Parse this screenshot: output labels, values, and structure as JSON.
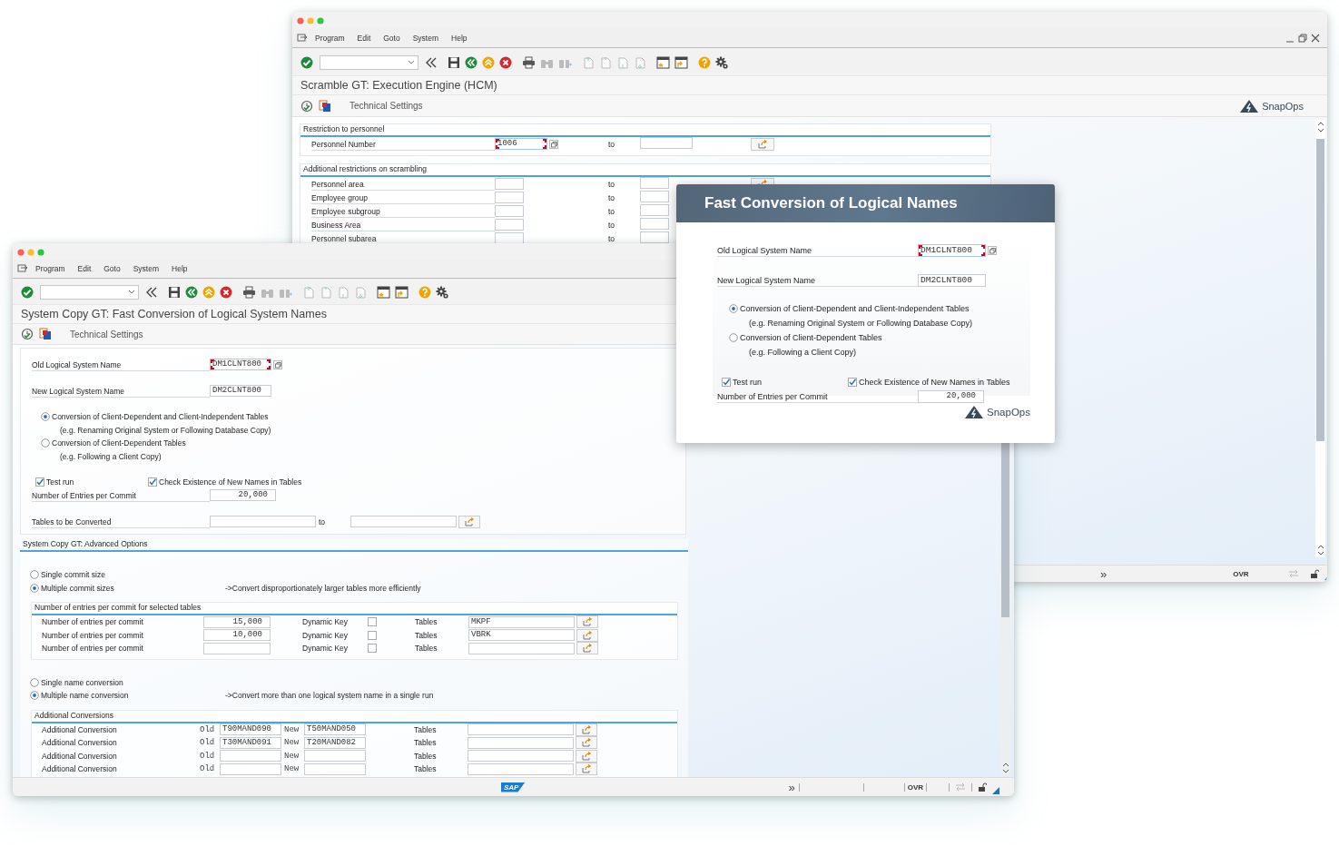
{
  "back_window": {
    "menu": [
      "Program",
      "Edit",
      "Goto",
      "System",
      "Help"
    ],
    "title": "Scramble GT: Execution Engine (HCM)",
    "app_toolbar": [
      "Technical Settings"
    ],
    "brand": "SnapOps",
    "groups": [
      {
        "title": "Restriction to personnel",
        "rows": [
          {
            "label": "Personnel Number",
            "low": "1006",
            "focused": true,
            "to": "to"
          }
        ]
      },
      {
        "title": "Additional restrictions on scrambling",
        "rows": [
          {
            "label": "Personnel area",
            "focused": false,
            "to": "to"
          },
          {
            "label": "Employee group",
            "focused": false,
            "to": "to"
          },
          {
            "label": "Employee subgroup",
            "focused": false,
            "to": "to"
          },
          {
            "label": "Business Area",
            "focused": false,
            "to": "to"
          },
          {
            "label": "Personnel subarea",
            "focused": false,
            "to": "to"
          }
        ]
      }
    ],
    "status": {
      "expand": "»",
      "mode": "OVR"
    }
  },
  "front_window": {
    "menu": [
      "Program",
      "Edit",
      "Goto",
      "System",
      "Help"
    ],
    "title": "System Copy GT: Fast Conversion of Logical System Names",
    "app_toolbar": [
      "Technical Settings"
    ],
    "old_name": {
      "label": "Old Logical System Name",
      "value": "DM1CLNT800",
      "focused": true
    },
    "new_name": {
      "label": "New Logical System Name",
      "value": "DM2CLNT800",
      "focused": false
    },
    "scope_options": [
      {
        "label": "Conversion of Client-Dependent and Client-Independent Tables",
        "hint": "(e.g. Renaming Original System or Following Database Copy)",
        "selected": true
      },
      {
        "label": "Conversion of Client-Dependent Tables",
        "hint": "(e.g. Following a Client Copy)",
        "selected": false
      }
    ],
    "checks": [
      {
        "label": "Test run",
        "checked": true
      },
      {
        "label": "Check Existence of New Names in Tables",
        "checked": true
      }
    ],
    "entries_per_commit": {
      "label": "Number of Entries per Commit",
      "value": "20,000"
    },
    "tables_range": {
      "label": "Tables to be Converted",
      "to": "to"
    },
    "advanced": {
      "title": "System Copy GT: Advanced Options",
      "commit_options": [
        {
          "label": "Single commit size",
          "selected": false
        },
        {
          "label": "Multiple commit sizes",
          "selected": true
        }
      ],
      "commit_note": "->Convert disproportionately larger tables more efficiently",
      "commit_table": {
        "title": "Number of entries per commit for selected tables",
        "rows": [
          {
            "label": "Number of entries per commit",
            "value": "15,000",
            "key_label": "Dynamic Key",
            "dynamic_key": false,
            "tables_label": "Tables",
            "tables": "MKPF"
          },
          {
            "label": "Number of entries per commit",
            "value": "10,000",
            "key_label": "Dynamic Key",
            "dynamic_key": false,
            "tables_label": "Tables",
            "tables": "VBRK"
          },
          {
            "label": "Number of entries per commit",
            "key_label": "Dynamic Key",
            "dynamic_key": false,
            "tables_label": "Tables"
          }
        ]
      },
      "name_options": [
        {
          "label": "Single name conversion",
          "selected": false
        },
        {
          "label": "Multiple name conversion",
          "selected": true
        }
      ],
      "name_note": "->Convert more than one logical system name in a single run",
      "conversions": {
        "title": "Additional Conversions",
        "rows": [
          {
            "label": "Additional Conversion",
            "old_label": "Old",
            "old": "T90MAND090",
            "new_label": "New",
            "new": "T50MAND050",
            "tables_label": "Tables"
          },
          {
            "label": "Additional Conversion",
            "old_label": "Old",
            "old": "T30MAND091",
            "new_label": "New",
            "new": "T20MAND082",
            "tables_label": "Tables"
          },
          {
            "label": "Additional Conversion",
            "old_label": "Old",
            "new_label": "New",
            "tables_label": "Tables"
          },
          {
            "label": "Additional Conversion",
            "old_label": "Old",
            "new_label": "New",
            "tables_label": "Tables"
          }
        ]
      }
    },
    "status": {
      "logo": "SAP",
      "expand": "»",
      "mode": "OVR"
    }
  },
  "popup": {
    "title": "Fast Conversion of Logical Names",
    "old_name": {
      "label": "Old Logical System Name",
      "value": "DM1CLNT800",
      "focused": true
    },
    "new_name": {
      "label": "New Logical System Name",
      "value": "DM2CLNT800",
      "focused": false
    },
    "scope_options": [
      {
        "label": "Conversion of Client-Dependent and Client-Independent Tables",
        "hint": "(e.g. Renaming Original System or Following Database Copy)",
        "selected": true
      },
      {
        "label": "Conversion of Client-Dependent Tables",
        "hint": "(e.g. Following a Client Copy)",
        "selected": false
      }
    ],
    "checks": [
      {
        "label": "Test run",
        "checked": true
      },
      {
        "label": "Check Existence of New Names in Tables",
        "checked": true
      }
    ],
    "entries_per_commit": {
      "label": "Number of Entries per Commit",
      "value": "20,000"
    },
    "brand": "SnapOps"
  }
}
